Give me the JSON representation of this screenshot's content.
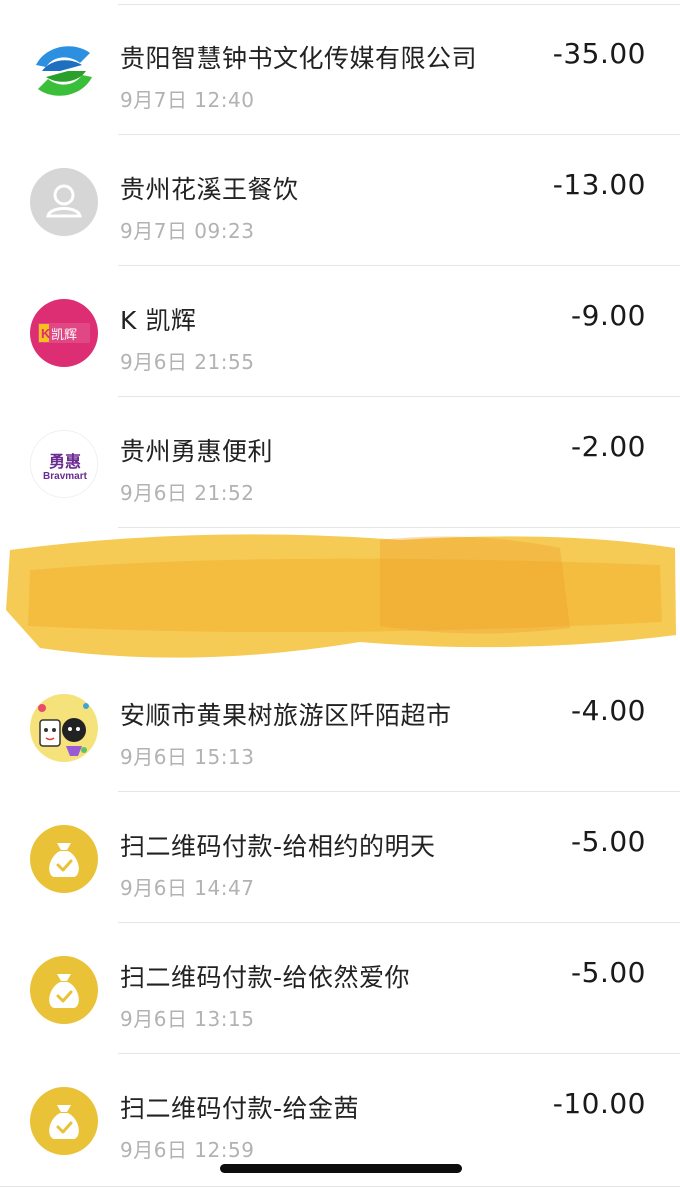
{
  "transactions": [
    {
      "name": "贵阳智慧钟书文化传媒有限公司",
      "time": "9月7日 12:40",
      "amount": "-35.00",
      "icon": "company-logo-icon"
    },
    {
      "name": "贵州花溪王餐饮",
      "time": "9月7日 09:23",
      "amount": "-13.00",
      "icon": "default-user-icon"
    },
    {
      "name": "K 凯辉",
      "time": "9月6日 21:55",
      "amount": "-9.00",
      "icon": "k-kaihui-logo-icon",
      "logo_text": "K凯辉"
    },
    {
      "name": "贵州勇惠便利",
      "time": "9月6日 21:52",
      "amount": "-2.00",
      "icon": "bravmart-logo-icon",
      "logo_text_cn": "勇惠",
      "logo_text_en": "Bravmart"
    },
    {
      "name": "安顺市黄果树旅游区阡陌超市",
      "time": "9月6日 15:13",
      "amount": "-4.00",
      "icon": "cartoon-avatar-icon"
    },
    {
      "name": "扫二维码付款-给相约的明天",
      "time": "9月6日 14:47",
      "amount": "-5.00",
      "icon": "money-bag-icon"
    },
    {
      "name": "扫二维码付款-给依然爱你",
      "time": "9月6日 13:15",
      "amount": "-5.00",
      "icon": "money-bag-icon"
    },
    {
      "name": "扫二维码付款-给金茜",
      "time": "9月6日 12:59",
      "amount": "-10.00",
      "icon": "money-bag-icon"
    }
  ],
  "colors": {
    "name_text": "#222222",
    "time_text": "#b2b2b2",
    "amount_text": "#1a1a1a",
    "divider": "#e6e6e6",
    "money_bag_bg": "#e9c237",
    "kaihui_bg": "#dd2e73",
    "bravmart_purple": "#6b2c91",
    "redaction": "#f5b63a"
  }
}
